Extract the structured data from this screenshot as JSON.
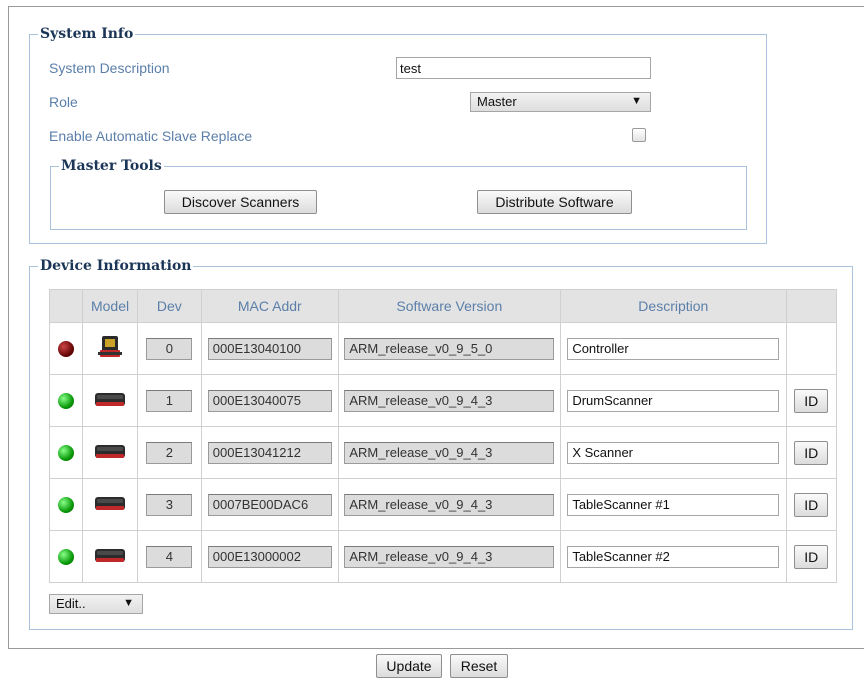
{
  "system_info": {
    "legend": "System Info",
    "description_label": "System Description",
    "description_value": "test",
    "role_label": "Role",
    "role_value": "Master",
    "auto_slave_label": "Enable Automatic Slave Replace",
    "auto_slave_checked": false,
    "master_tools": {
      "legend": "Master Tools",
      "discover_label": "Discover Scanners",
      "distribute_label": "Distribute Software"
    }
  },
  "device_info": {
    "legend": "Device Information",
    "columns": [
      "",
      "Model",
      "Dev",
      "MAC Addr",
      "Software Version",
      "Description",
      ""
    ],
    "rows": [
      {
        "status": "red",
        "model": "controller-icon",
        "dev": "0",
        "mac": "000E13040100",
        "software": "ARM_release_v0_9_5_0",
        "description": "Controller",
        "id_button": ""
      },
      {
        "status": "green",
        "model": "scanner-icon",
        "dev": "1",
        "mac": "000E13040075",
        "software": "ARM_release_v0_9_4_3",
        "description": "DrumScanner",
        "id_button": "ID"
      },
      {
        "status": "green",
        "model": "scanner-icon",
        "dev": "2",
        "mac": "000E13041212",
        "software": "ARM_release_v0_9_4_3",
        "description": "X Scanner",
        "id_button": "ID"
      },
      {
        "status": "green",
        "model": "scanner-icon",
        "dev": "3",
        "mac": "0007BE00DAC6",
        "software": "ARM_release_v0_9_4_3",
        "description": "TableScanner #1",
        "id_button": "ID"
      },
      {
        "status": "green",
        "model": "scanner-icon",
        "dev": "4",
        "mac": "000E13000002",
        "software": "ARM_release_v0_9_4_3",
        "description": "TableScanner #2",
        "id_button": "ID"
      }
    ],
    "edit_select": "Edit..",
    "colors": {
      "header_bg": "#e3e3e3",
      "label": "#5b7fa9",
      "led_ok": "#0a9a0a",
      "led_off": "#5a0000"
    }
  },
  "footer": {
    "update_label": "Update",
    "reset_label": "Reset"
  }
}
